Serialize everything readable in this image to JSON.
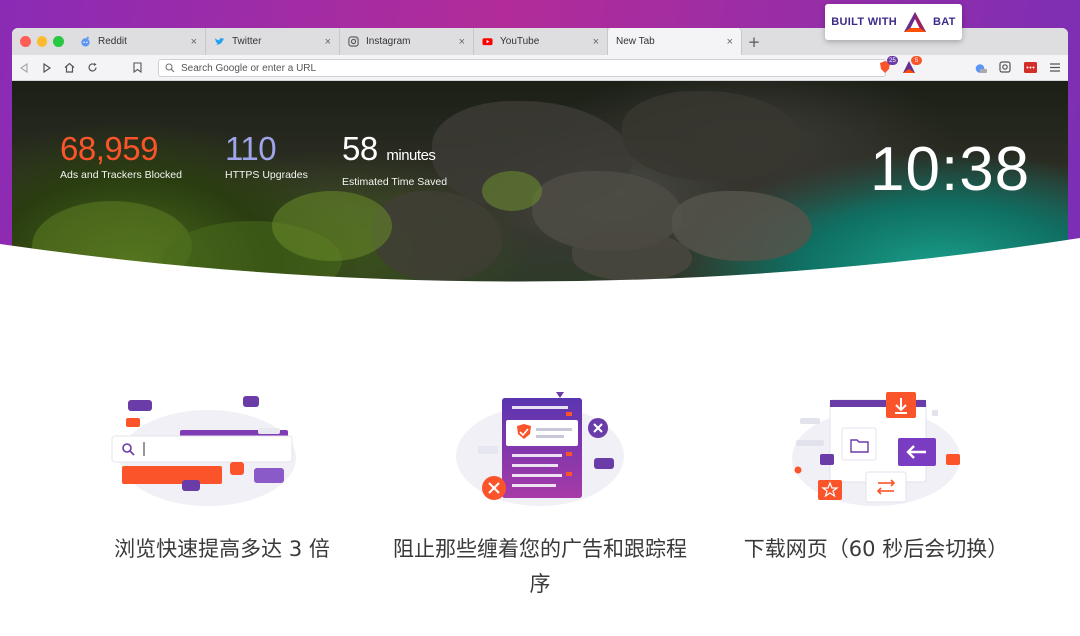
{
  "badge": {
    "prefix": "BUILT WITH",
    "brand": "BAT"
  },
  "tabs": [
    {
      "label": "Reddit",
      "icon": "reddit-icon",
      "color": "#5b95f5"
    },
    {
      "label": "Twitter",
      "icon": "twitter-icon",
      "color": "#1da1f2"
    },
    {
      "label": "Instagram",
      "icon": "instagram-icon",
      "color": "#555555"
    },
    {
      "label": "YouTube",
      "icon": "youtube-icon",
      "color": "#ff0000"
    },
    {
      "label": "New Tab",
      "icon": "",
      "color": ""
    }
  ],
  "toolbar": {
    "url_placeholder": "Search Google or enter a URL",
    "shield_count": "25",
    "rewards_count": "5"
  },
  "stats": {
    "ads_blocked": {
      "value": "68,959",
      "label": "Ads and Trackers Blocked",
      "color": "#fb542b"
    },
    "https_upgrades": {
      "value": "110",
      "label": "HTTPS Upgrades",
      "color": "#a0a5eb"
    },
    "time_saved": {
      "value": "58",
      "unit": "minutes",
      "label": "Estimated Time Saved",
      "color": "#ffffff"
    }
  },
  "clock": "10:38",
  "features": [
    {
      "text": "浏览快速提高多达 3 倍"
    },
    {
      "text": "阻止那些缠着您的广告和跟踪程序"
    },
    {
      "text": "下载网页（60 秒后会切换）"
    }
  ],
  "colors": {
    "brand_orange": "#fb542b",
    "brand_purple": "#662d91",
    "accent_purple": "#a0a5eb"
  }
}
